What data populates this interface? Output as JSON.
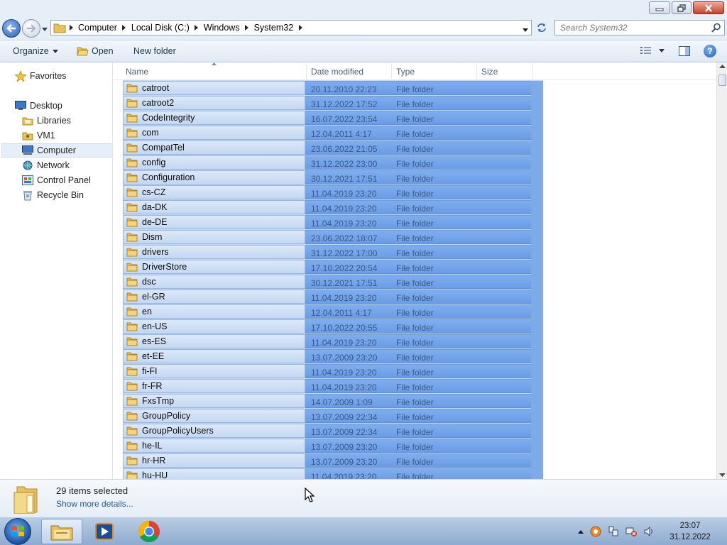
{
  "window": {
    "address": [
      "Computer",
      "Local Disk (C:)",
      "Windows",
      "System32"
    ],
    "search_placeholder": "Search System32"
  },
  "toolbar": {
    "organize": "Organize",
    "open": "Open",
    "new_folder": "New folder"
  },
  "nav": {
    "favorites": "Favorites",
    "desktop": "Desktop",
    "libraries": "Libraries",
    "vm1": "VM1",
    "computer": "Computer",
    "network": "Network",
    "control_panel": "Control Panel",
    "recycle_bin": "Recycle Bin"
  },
  "columns": {
    "name": "Name",
    "date": "Date modified",
    "type": "Type",
    "size": "Size"
  },
  "files": [
    {
      "name": "catroot",
      "date": "20.11.2010 22:23",
      "type": "File folder"
    },
    {
      "name": "catroot2",
      "date": "31.12.2022 17:52",
      "type": "File folder"
    },
    {
      "name": "CodeIntegrity",
      "date": "16.07.2022 23:54",
      "type": "File folder"
    },
    {
      "name": "com",
      "date": "12.04.2011 4:17",
      "type": "File folder"
    },
    {
      "name": "CompatTel",
      "date": "23.06.2022 21:05",
      "type": "File folder"
    },
    {
      "name": "config",
      "date": "31.12.2022 23:00",
      "type": "File folder"
    },
    {
      "name": "Configuration",
      "date": "30.12.2021 17:51",
      "type": "File folder"
    },
    {
      "name": "cs-CZ",
      "date": "11.04.2019 23:20",
      "type": "File folder"
    },
    {
      "name": "da-DK",
      "date": "11.04.2019 23:20",
      "type": "File folder"
    },
    {
      "name": "de-DE",
      "date": "11.04.2019 23:20",
      "type": "File folder"
    },
    {
      "name": "Dism",
      "date": "23.06.2022 18:07",
      "type": "File folder"
    },
    {
      "name": "drivers",
      "date": "31.12.2022 17:00",
      "type": "File folder"
    },
    {
      "name": "DriverStore",
      "date": "17.10.2022 20:54",
      "type": "File folder"
    },
    {
      "name": "dsc",
      "date": "30.12.2021 17:51",
      "type": "File folder"
    },
    {
      "name": "el-GR",
      "date": "11.04.2019 23:20",
      "type": "File folder"
    },
    {
      "name": "en",
      "date": "12.04.2011 4:17",
      "type": "File folder"
    },
    {
      "name": "en-US",
      "date": "17.10.2022 20:55",
      "type": "File folder"
    },
    {
      "name": "es-ES",
      "date": "11.04.2019 23:20",
      "type": "File folder"
    },
    {
      "name": "et-EE",
      "date": "13.07.2009 23:20",
      "type": "File folder"
    },
    {
      "name": "fi-FI",
      "date": "11.04.2019 23:20",
      "type": "File folder"
    },
    {
      "name": "fr-FR",
      "date": "11.04.2019 23:20",
      "type": "File folder"
    },
    {
      "name": "FxsTmp",
      "date": "14.07.2009 1:09",
      "type": "File folder"
    },
    {
      "name": "GroupPolicy",
      "date": "13.07.2009 22:34",
      "type": "File folder"
    },
    {
      "name": "GroupPolicyUsers",
      "date": "13.07.2009 22:34",
      "type": "File folder"
    },
    {
      "name": "he-IL",
      "date": "13.07.2009 23:20",
      "type": "File folder"
    },
    {
      "name": "hr-HR",
      "date": "13.07.2009 23:20",
      "type": "File folder"
    },
    {
      "name": "hu-HU",
      "date": "11.04.2019 23:20",
      "type": "File folder"
    }
  ],
  "details": {
    "count": "29 items selected",
    "more": "Show more details..."
  },
  "taskbar": {
    "time": "23:07",
    "date": "31.12.2022"
  },
  "colors": {
    "selection_fill": "#6a9ce6",
    "name_cell": "#c4d8f2",
    "link": "#1e5aa8"
  }
}
